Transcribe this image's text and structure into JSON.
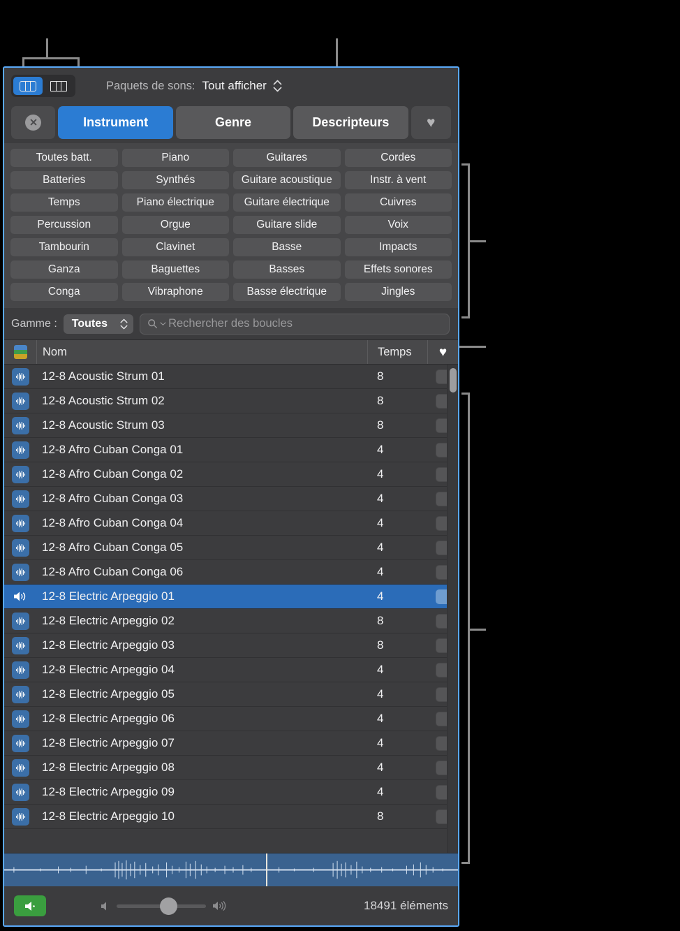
{
  "toolbar": {
    "view_grid_icon": "grid-view-icon",
    "view_column_icon": "column-view-icon",
    "sound_packs_label": "Paquets de sons:",
    "sound_packs_value": "Tout afficher"
  },
  "tabs": {
    "clear_icon": "clear-x-icon",
    "instrument": "Instrument",
    "genre": "Genre",
    "descriptors": "Descripteurs",
    "favorite_icon": "heart-icon"
  },
  "keywords": [
    "Toutes batt.",
    "Piano",
    "Guitares",
    "Cordes",
    "Batteries",
    "Synthés",
    "Guitare acoustique",
    "Instr. à vent",
    "Temps",
    "Piano électrique",
    "Guitare électrique",
    "Cuivres",
    "Percussion",
    "Orgue",
    "Guitare slide",
    "Voix",
    "Tambourin",
    "Clavinet",
    "Basse",
    "Impacts",
    "Ganza",
    "Baguettes",
    "Basses",
    "Effets sonores",
    "Conga",
    "Vibraphone",
    "Basse électrique",
    "Jingles"
  ],
  "search": {
    "scale_label": "Gamme :",
    "scale_value": "Toutes",
    "search_icon": "search-icon",
    "placeholder": "Rechercher des boucles"
  },
  "table": {
    "header": {
      "icon": "color-stripes-icon",
      "name": "Nom",
      "time": "Temps",
      "favorite": "heart-icon"
    },
    "rows": [
      {
        "name": "12-8 Acoustic Strum 01",
        "time": "8",
        "selected": false
      },
      {
        "name": "12-8 Acoustic Strum 02",
        "time": "8",
        "selected": false
      },
      {
        "name": "12-8 Acoustic Strum 03",
        "time": "8",
        "selected": false
      },
      {
        "name": "12-8 Afro Cuban Conga 01",
        "time": "4",
        "selected": false
      },
      {
        "name": "12-8 Afro Cuban Conga 02",
        "time": "4",
        "selected": false
      },
      {
        "name": "12-8 Afro Cuban Conga 03",
        "time": "4",
        "selected": false
      },
      {
        "name": "12-8 Afro Cuban Conga 04",
        "time": "4",
        "selected": false
      },
      {
        "name": "12-8 Afro Cuban Conga 05",
        "time": "4",
        "selected": false
      },
      {
        "name": "12-8 Afro Cuban Conga 06",
        "time": "4",
        "selected": false
      },
      {
        "name": "12-8 Electric Arpeggio 01",
        "time": "4",
        "selected": true
      },
      {
        "name": "12-8 Electric Arpeggio 02",
        "time": "8",
        "selected": false
      },
      {
        "name": "12-8 Electric Arpeggio 03",
        "time": "8",
        "selected": false
      },
      {
        "name": "12-8 Electric Arpeggio 04",
        "time": "4",
        "selected": false
      },
      {
        "name": "12-8 Electric Arpeggio 05",
        "time": "4",
        "selected": false
      },
      {
        "name": "12-8 Electric Arpeggio 06",
        "time": "4",
        "selected": false
      },
      {
        "name": "12-8 Electric Arpeggio 07",
        "time": "4",
        "selected": false
      },
      {
        "name": "12-8 Electric Arpeggio 08",
        "time": "4",
        "selected": false
      },
      {
        "name": "12-8 Electric Arpeggio 09",
        "time": "4",
        "selected": false
      },
      {
        "name": "12-8 Electric Arpeggio 10",
        "time": "8",
        "selected": false
      }
    ]
  },
  "bottom": {
    "play_icon": "speaker-play-icon",
    "volume_low_icon": "volume-low-icon",
    "volume_high_icon": "volume-high-icon",
    "items_count": "18491 éléments"
  },
  "colors": {
    "accent_blue": "#2b7cd3",
    "window_border": "#5aa9f8",
    "selection_blue": "#2b6cb8",
    "play_green": "#3a9e3f",
    "waveform_blue": "#3a628f",
    "stripe_blue": "#4a86c8",
    "stripe_green": "#3f9c4a",
    "stripe_yellow": "#c9a227"
  }
}
